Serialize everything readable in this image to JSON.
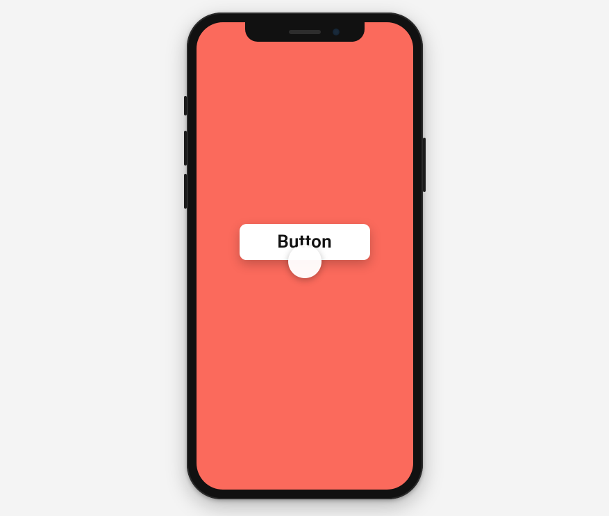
{
  "colors": {
    "screen_background": "#fb6a5c",
    "button_background": "#ffffff",
    "button_text": "#111111"
  },
  "button": {
    "label": "Button"
  }
}
